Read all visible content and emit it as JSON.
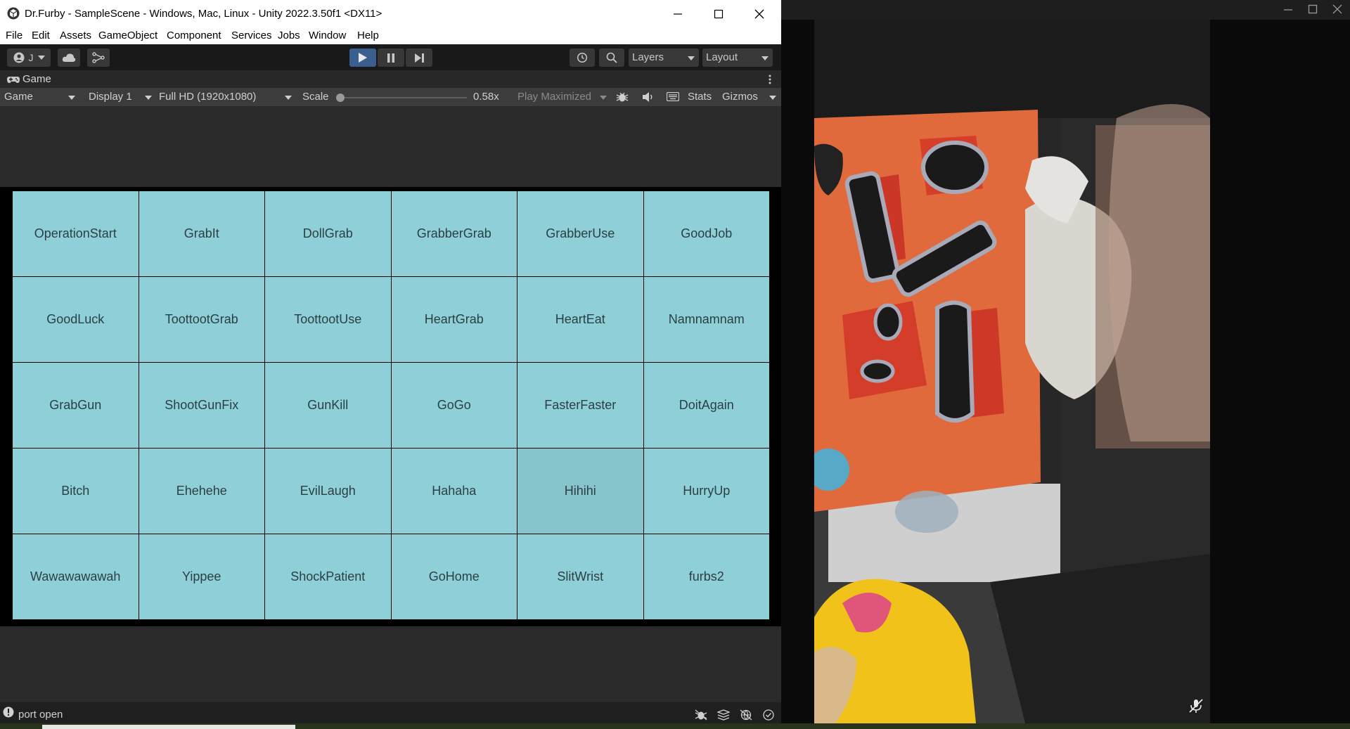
{
  "unity_window": {
    "title": "Dr.Furby - SampleScene - Windows, Mac, Linux - Unity 2022.3.50f1 <DX11>",
    "menu": [
      "File",
      "Edit",
      "Assets",
      "GameObject",
      "Component",
      "Services",
      "Jobs",
      "Window",
      "Help"
    ],
    "toolbar": {
      "account_label": "J",
      "layers_label": "Layers",
      "layout_label": "Layout"
    },
    "tab": {
      "label": "Game"
    },
    "game_bar": {
      "mode": "Game",
      "display": "Display 1",
      "resolution": "Full HD (1920x1080)",
      "scale_label": "Scale",
      "scale_value": "0.58x",
      "scale_fraction": 0.0,
      "play_mode": "Play Maximized",
      "stats": "Stats",
      "gizmos": "Gizmos"
    },
    "buttons": [
      "OperationStart",
      "GrabIt",
      "DollGrab",
      "GrabberGrab",
      "GrabberUse",
      "GoodJob",
      "GoodLuck",
      "ToottootGrab",
      "ToottootUse",
      "HeartGrab",
      "HeartEat",
      "Namnamnam",
      "GrabGun",
      "ShootGunFix",
      "GunKill",
      "GoGo",
      "FasterFaster",
      "DoitAgain",
      "Bitch",
      "Ehehehe",
      "EvilLaugh",
      "Hahaha",
      "Hihihi",
      "HurryUp",
      "Wawawawawah",
      "Yippee",
      "ShockPatient",
      "GoHome",
      "SlitWrist",
      "furbs2"
    ],
    "highlighted_button": "Hihihi",
    "status": "port open"
  },
  "colors": {
    "button_bg": "#8fd0d8",
    "button_hover_bg": "#87c4cb",
    "play_active": "#3a5f8f",
    "editor_bg": "#282828"
  }
}
